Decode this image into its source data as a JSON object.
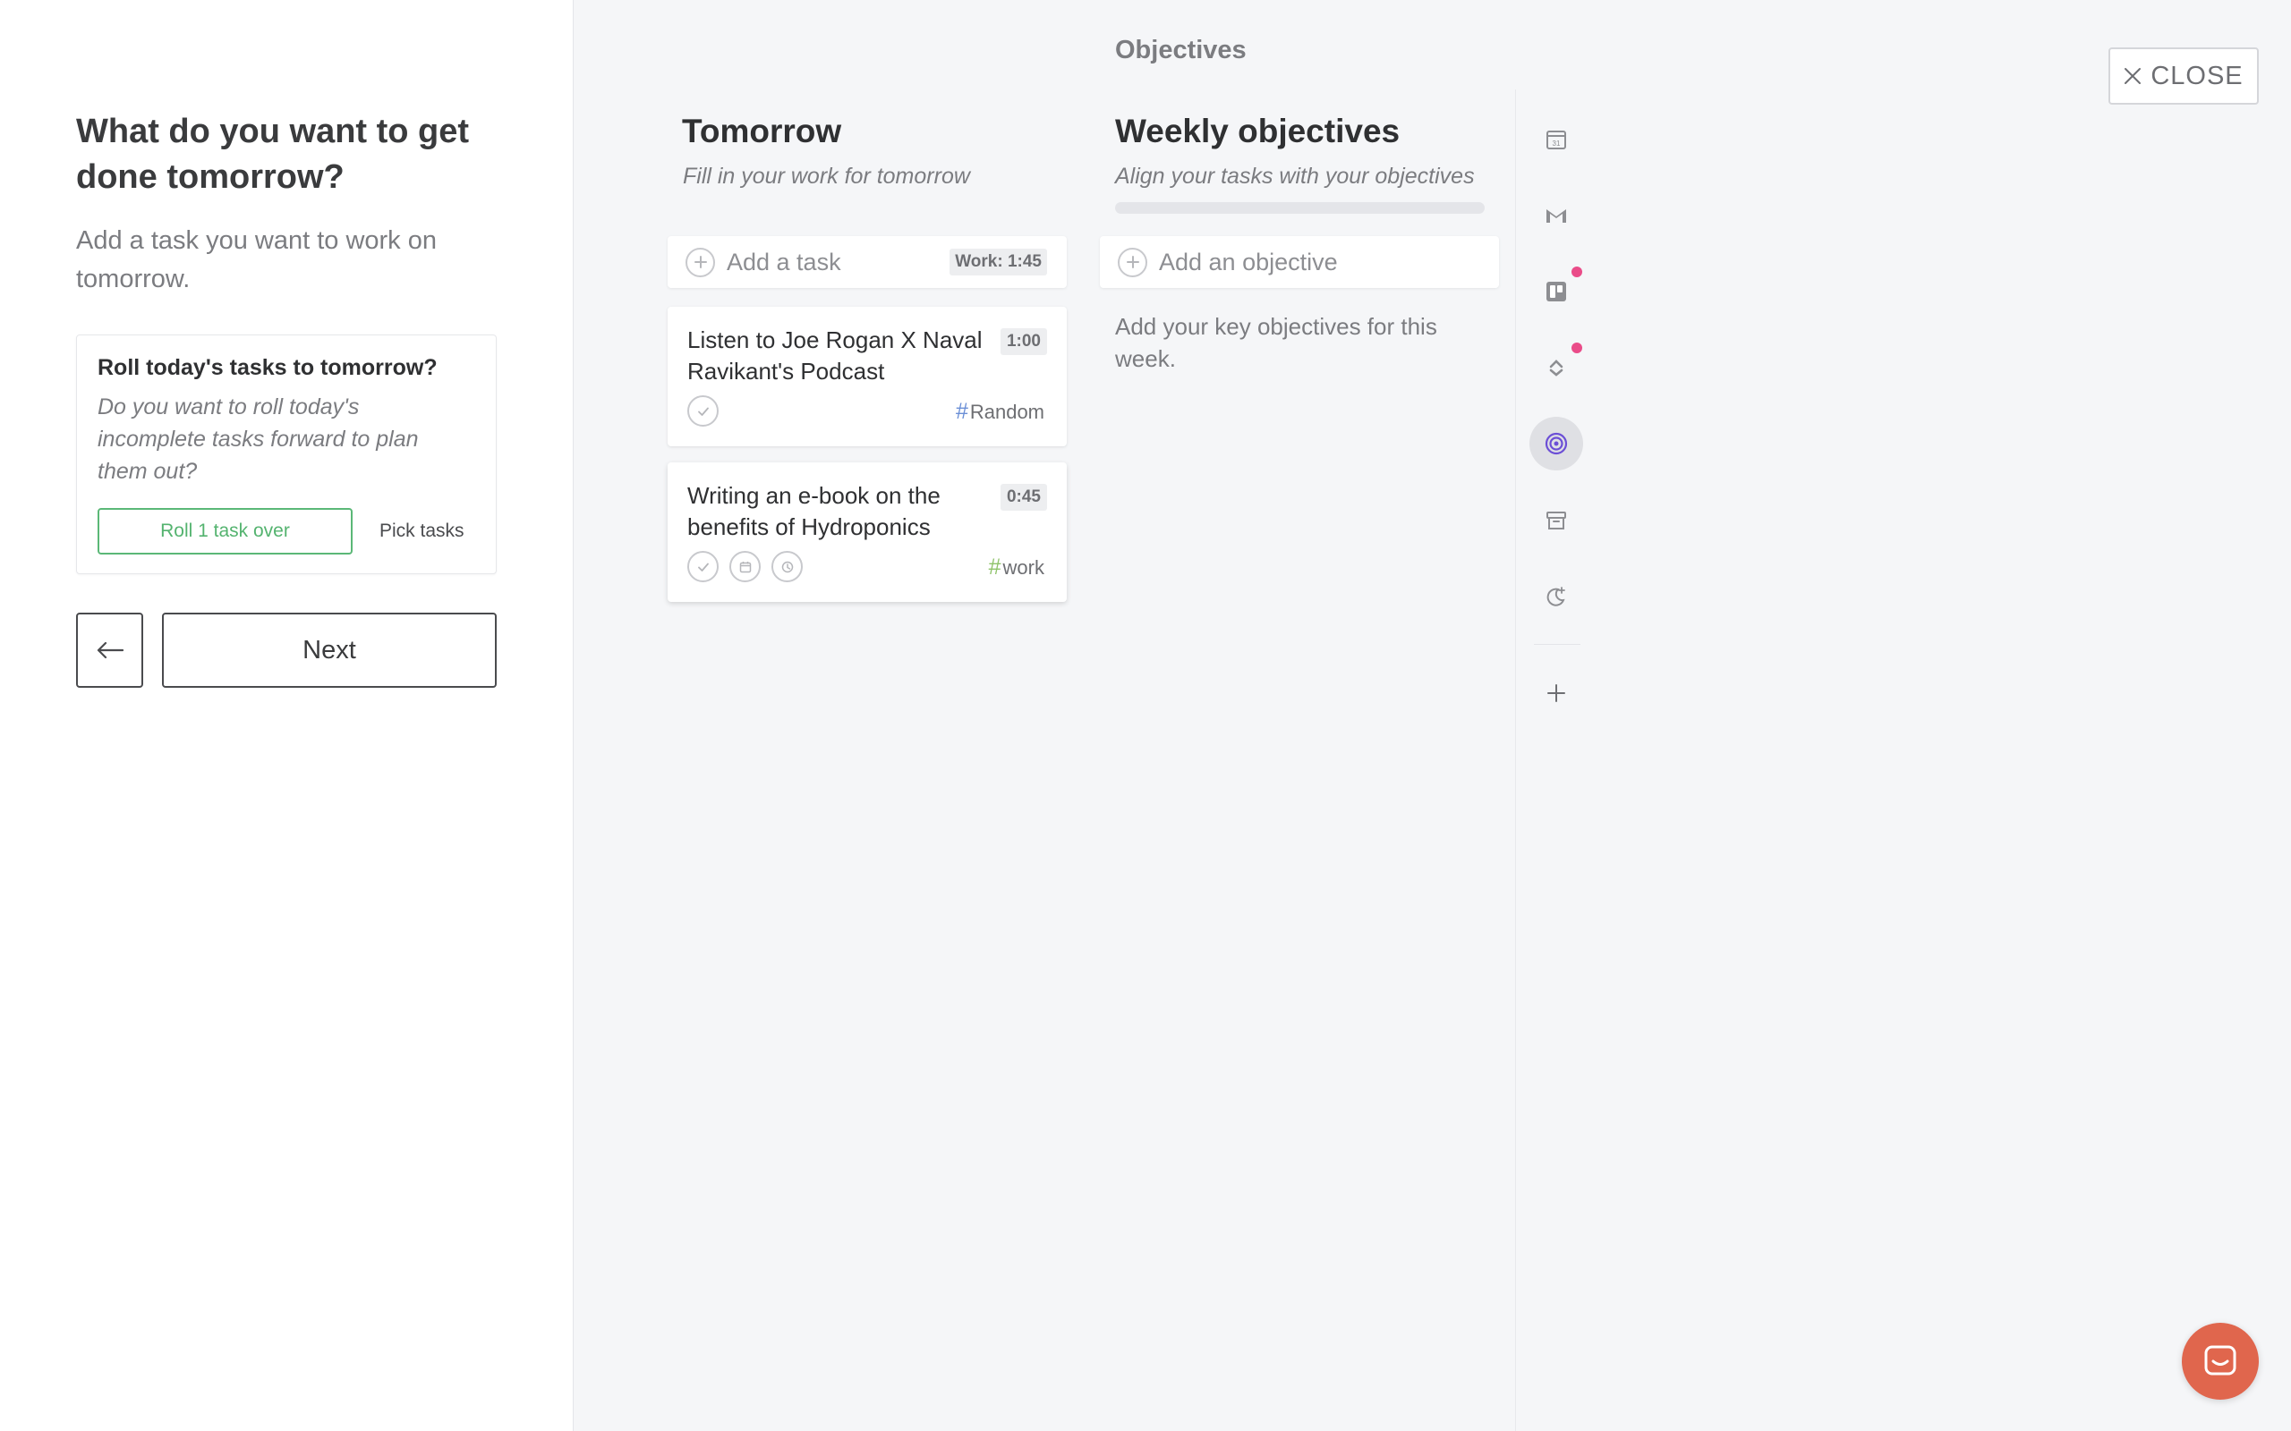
{
  "left": {
    "title": "What do you want to get done tomorrow?",
    "subtitle": "Add a task you want to work on tomorrow.",
    "roll_card": {
      "title": "Roll today's tasks to tomorrow?",
      "text": "Do you want to roll today's incomplete tasks forward to plan them out?",
      "roll_button": "Roll 1 task over",
      "pick_button": "Pick tasks"
    },
    "next_button": "Next"
  },
  "header": {
    "title": "Objectives",
    "close_label": "CLOSE"
  },
  "tomorrow": {
    "title": "Tomorrow",
    "subtitle": "Fill in your work for tomorrow",
    "add_task_label": "Add a task",
    "work_badge": "Work: 1:45",
    "tasks": [
      {
        "title": "Listen to Joe Rogan X Naval Ravikant's Podcast",
        "time": "1:00",
        "tag": "Random",
        "tag_color": "#6b8fd6"
      },
      {
        "title": "Writing an e-book on the benefits of Hydroponics",
        "time": "0:45",
        "tag": "work",
        "tag_color": "#8fc36a"
      }
    ]
  },
  "weekly": {
    "title": "Weekly objectives",
    "subtitle": "Align your tasks with your objectives",
    "add_objective_label": "Add an objective",
    "hint": "Add your key objectives for this week.",
    "progress": 0
  },
  "rail": {
    "items": [
      "calendar-icon",
      "gmail-icon",
      "trello-icon",
      "asana-icon",
      "objectives-icon",
      "archive-icon",
      "shutdown-icon",
      "add-icon"
    ],
    "accent": "#6c4fd6",
    "notification_color": "#ea4c89"
  },
  "chat": {
    "color": "#e0664d"
  }
}
